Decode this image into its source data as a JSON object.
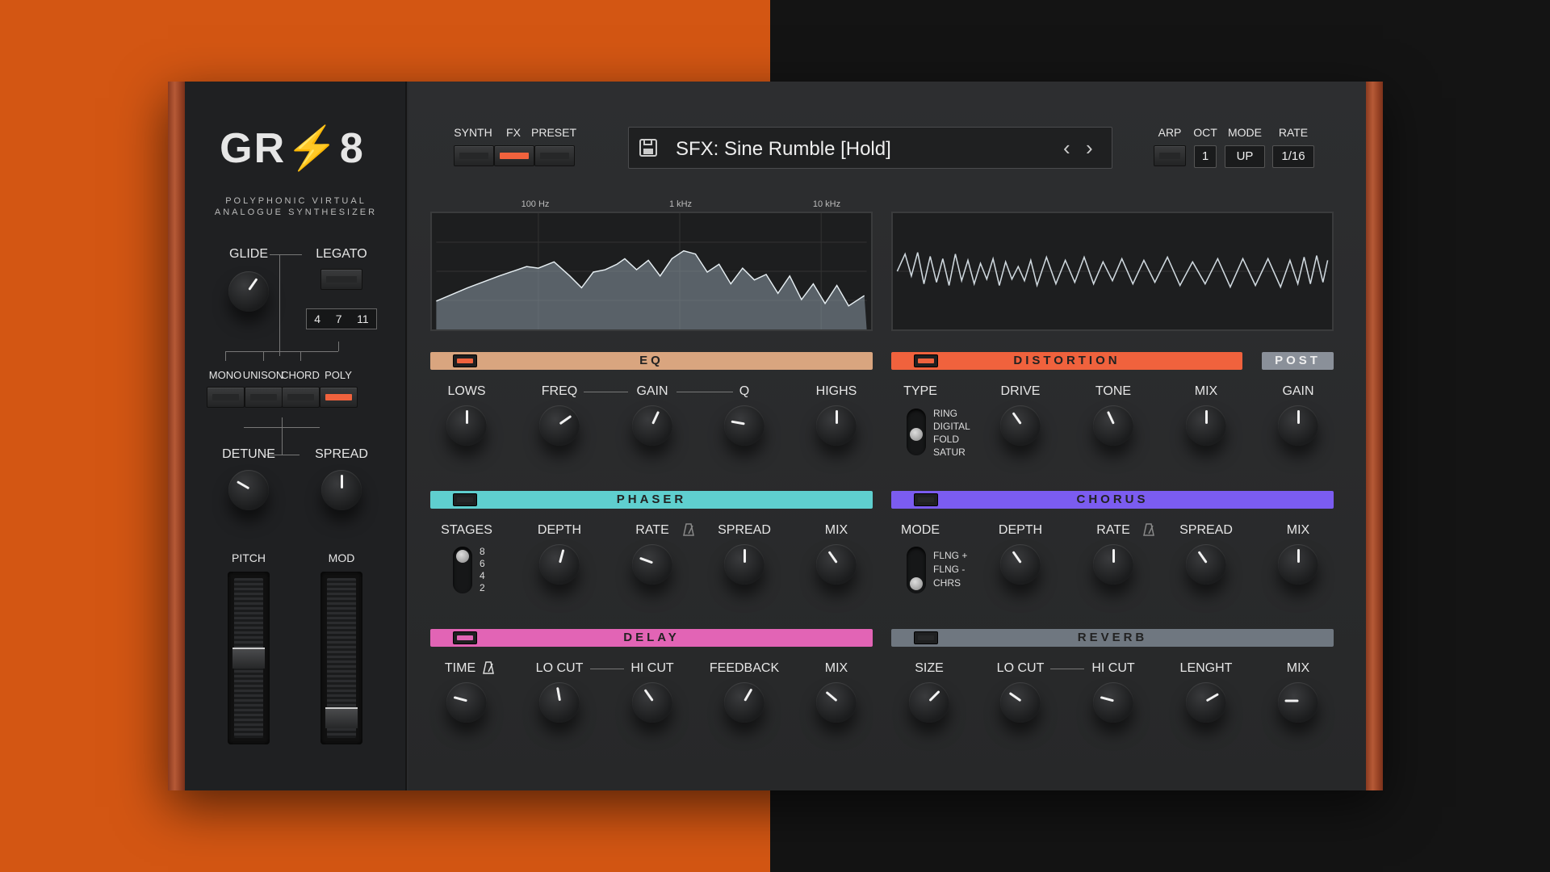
{
  "logo": "GR⚡8",
  "tagline": [
    "POLYPHONIC VIRTUAL",
    "ANALOGUE SYNTHESIZER"
  ],
  "colors": {
    "accent": "#f0623d",
    "eq": "#d9a57f",
    "distortion": "#f0623d",
    "phaser": "#5fcfcf",
    "chorus": "#7b5cf0",
    "delay": "#e264b5",
    "reverb": "#6f7780",
    "post": "#8a9099"
  },
  "sidebar": {
    "glide": "GLIDE",
    "legato": "LEGATO",
    "chord_notes": [
      "4",
      "7",
      "11"
    ],
    "voice_modes": [
      "MONO",
      "UNISON",
      "CHORD",
      "POLY"
    ],
    "active_mode": "POLY",
    "detune": "DETUNE",
    "spread": "SPREAD",
    "pitch": "PITCH",
    "mod": "MOD"
  },
  "header": {
    "tabs": [
      "SYNTH",
      "FX",
      "PRESET"
    ],
    "active_tab": "FX",
    "preset_name": "SFX: Sine Rumble [Hold]",
    "arp": "ARP",
    "oct": "OCT",
    "mode": "MODE",
    "rate": "RATE",
    "oct_value": "1",
    "mode_value": "UP",
    "rate_value": "1/16"
  },
  "spectrum": {
    "ticks": [
      "100 Hz",
      "1 kHz",
      "10 kHz"
    ]
  },
  "eq": {
    "title": "EQ",
    "knobs": [
      "LOWS",
      "FREQ",
      "GAIN",
      "Q",
      "HIGHS"
    ]
  },
  "distortion": {
    "title": "DISTORTION",
    "post": "POST",
    "type": "TYPE",
    "types": [
      "RING",
      "DIGITAL",
      "FOLD",
      "SATUR"
    ],
    "knobs": [
      "DRIVE",
      "TONE",
      "MIX",
      "GAIN"
    ]
  },
  "phaser": {
    "title": "PHASER",
    "stages": "STAGES",
    "stage_opts": [
      "8",
      "6",
      "4",
      "2"
    ],
    "knobs": [
      "DEPTH",
      "RATE",
      "SPREAD",
      "MIX"
    ]
  },
  "chorus": {
    "title": "CHORUS",
    "mode": "MODE",
    "modes": [
      "FLNG +",
      "FLNG -",
      "CHRS"
    ],
    "knobs": [
      "DEPTH",
      "RATE",
      "SPREAD",
      "MIX"
    ]
  },
  "delay": {
    "title": "DELAY",
    "knobs": [
      "TIME",
      "LO CUT",
      "HI CUT",
      "FEEDBACK",
      "MIX"
    ]
  },
  "reverb": {
    "title": "REVERB",
    "knobs": [
      "SIZE",
      "LO CUT",
      "HI CUT",
      "LENGHT",
      "MIX"
    ]
  }
}
